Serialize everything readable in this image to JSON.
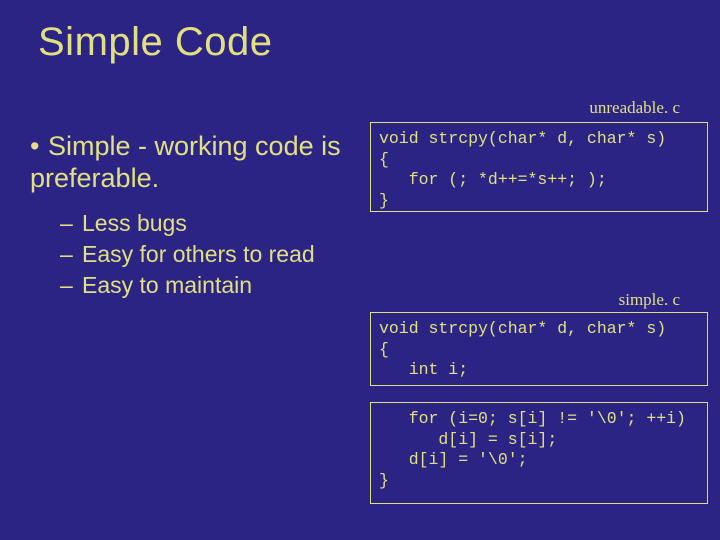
{
  "title": "Simple Code",
  "bullet": {
    "marker": "•",
    "text": "Simple - working code is preferable."
  },
  "subs": {
    "dash": "–",
    "items": [
      "Less bugs",
      "Easy for others to read",
      "Easy to maintain"
    ]
  },
  "labels": {
    "unreadable": "unreadable. c",
    "simple": "simple. c"
  },
  "code": {
    "unreadable": "void strcpy(char* d, char* s)\n{\n   for (; *d++=*s++; );\n}",
    "simple_head": "void strcpy(char* d, char* s)\n{\n   int i;",
    "simple_body": "   for (i=0; s[i] != '\\0'; ++i)\n      d[i] = s[i];\n   d[i] = '\\0';\n}"
  }
}
